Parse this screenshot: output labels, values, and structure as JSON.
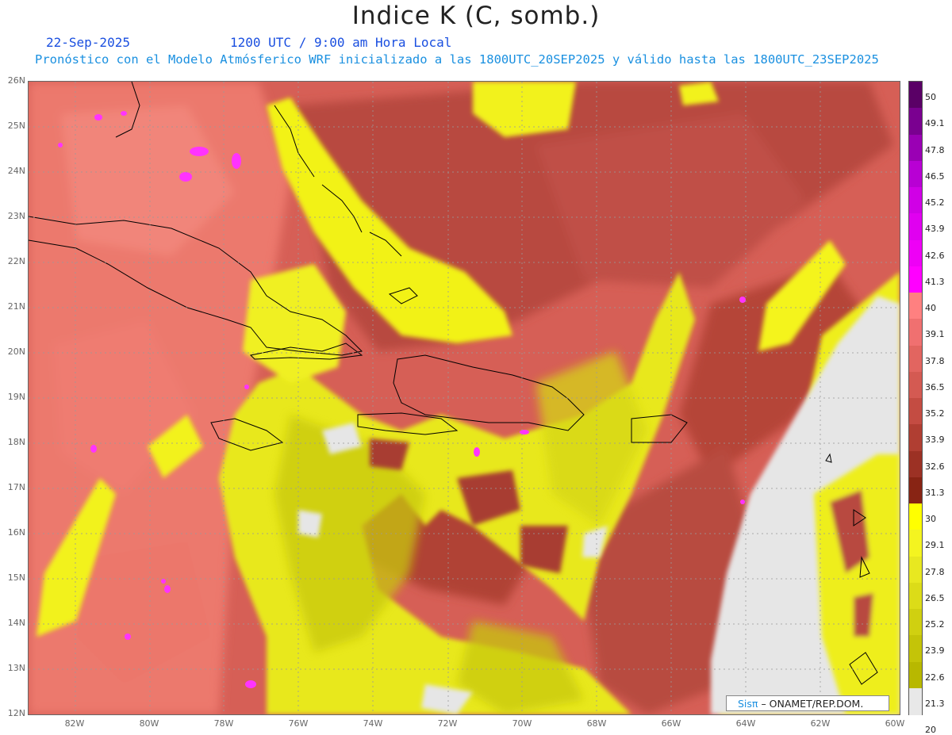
{
  "header": {
    "title": "Indice K (C, somb.)",
    "date": "22-Sep-2025",
    "time": "1200 UTC / 9:00 am Hora Local",
    "subtitle": "Pronóstico con el Modelo Atmósferico WRF inicializado a las 1800UTC_20SEP2025 y válido hasta las  1800UTC_23SEP2025"
  },
  "map": {
    "lat_labels": [
      "26N",
      "25N",
      "24N",
      "23N",
      "22N",
      "21N",
      "20N",
      "19N",
      "18N",
      "17N",
      "16N",
      "15N",
      "14N",
      "13N",
      "12N"
    ],
    "lon_labels": [
      "82W",
      "80W",
      "78W",
      "76W",
      "74W",
      "72W",
      "70W",
      "68W",
      "66W",
      "64W",
      "62W",
      "60W"
    ]
  },
  "colorbar": {
    "labels": [
      "50",
      "49.1",
      "47.8",
      "46.5",
      "45.2",
      "43.9",
      "42.6",
      "41.3",
      "40",
      "39.1",
      "37.8",
      "36.5",
      "35.2",
      "33.9",
      "32.6",
      "31.3",
      "30",
      "29.1",
      "27.8",
      "26.5",
      "25.2",
      "23.9",
      "22.6",
      "21.3",
      "20"
    ],
    "colors": [
      "#5a0066",
      "#7a0090",
      "#9a00b4",
      "#b800d4",
      "#d000e6",
      "#e000f0",
      "#ee00f6",
      "#ff00ff",
      "#ff8080",
      "#f07070",
      "#e26560",
      "#d45a52",
      "#c44c42",
      "#b03e32",
      "#9c3124",
      "#882414",
      "#ffff00",
      "#f4f420",
      "#e8e820",
      "#dcdc18",
      "#d0d010",
      "#c4c408",
      "#b8b800",
      "#e8e8e8"
    ],
    "accent_land": "#000000"
  },
  "credit": {
    "brand": "Sisπ",
    "text": "– ONAMET/REP.DOM."
  }
}
